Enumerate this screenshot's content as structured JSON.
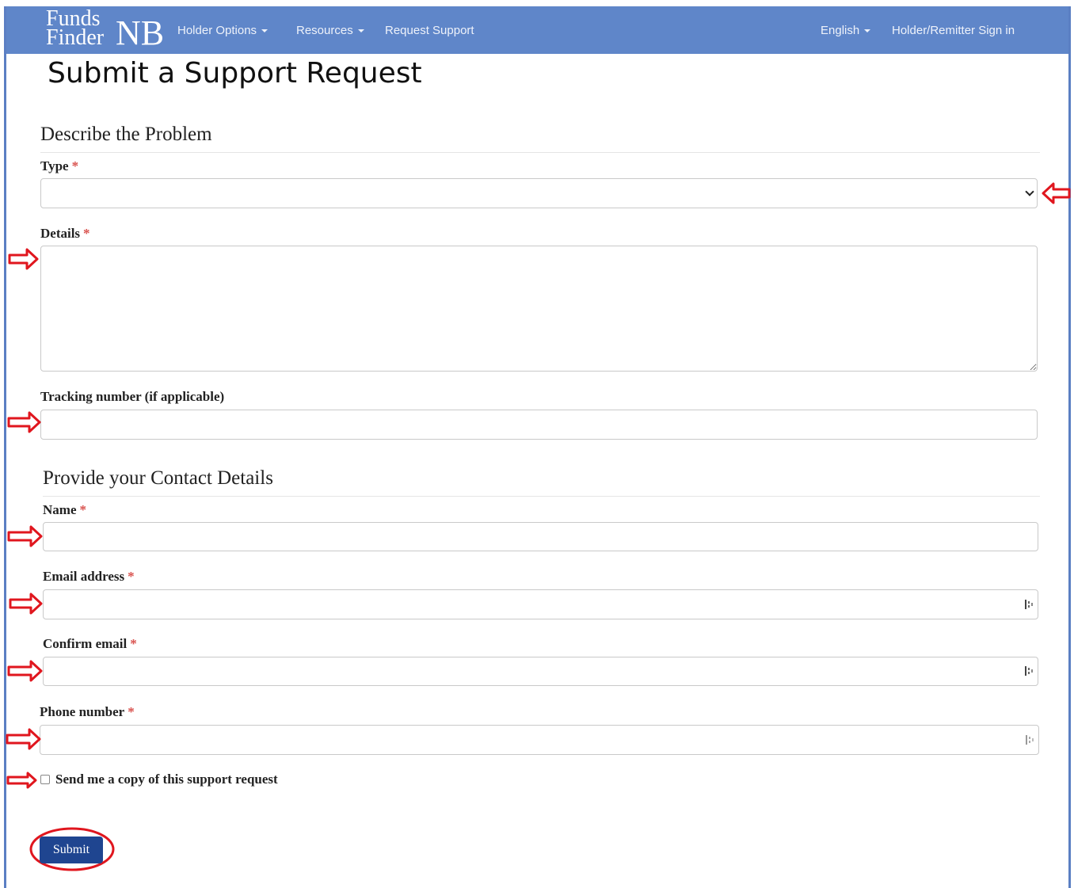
{
  "brand": {
    "line1": "Funds",
    "line2": "Finder",
    "suffix": "NB"
  },
  "nav": {
    "holder_options": "Holder Options",
    "resources": "Resources",
    "request_support": "Request Support",
    "language": "English",
    "sign_in": "Holder/Remitter Sign in"
  },
  "page_title": "Submit a Support Request",
  "problem_section": {
    "title": "Describe the Problem",
    "type_label": "Type",
    "type_value": "",
    "details_label": "Details",
    "details_value": "",
    "tracking_label": "Tracking number (if applicable)",
    "tracking_value": ""
  },
  "contact_section": {
    "title": "Provide your Contact Details",
    "name_label": "Name",
    "name_value": "",
    "email_label": "Email address",
    "email_value": "",
    "confirm_email_label": "Confirm email",
    "confirm_email_value": "",
    "phone_label": "Phone number",
    "phone_value": ""
  },
  "required_marker": "*",
  "copy_checkbox": {
    "label": "Send me a copy of this support request",
    "checked": false
  },
  "submit_label": "Submit",
  "colors": {
    "navbar": "#5f86c9",
    "annotation": "#e0161e",
    "submit": "#1f4590"
  }
}
